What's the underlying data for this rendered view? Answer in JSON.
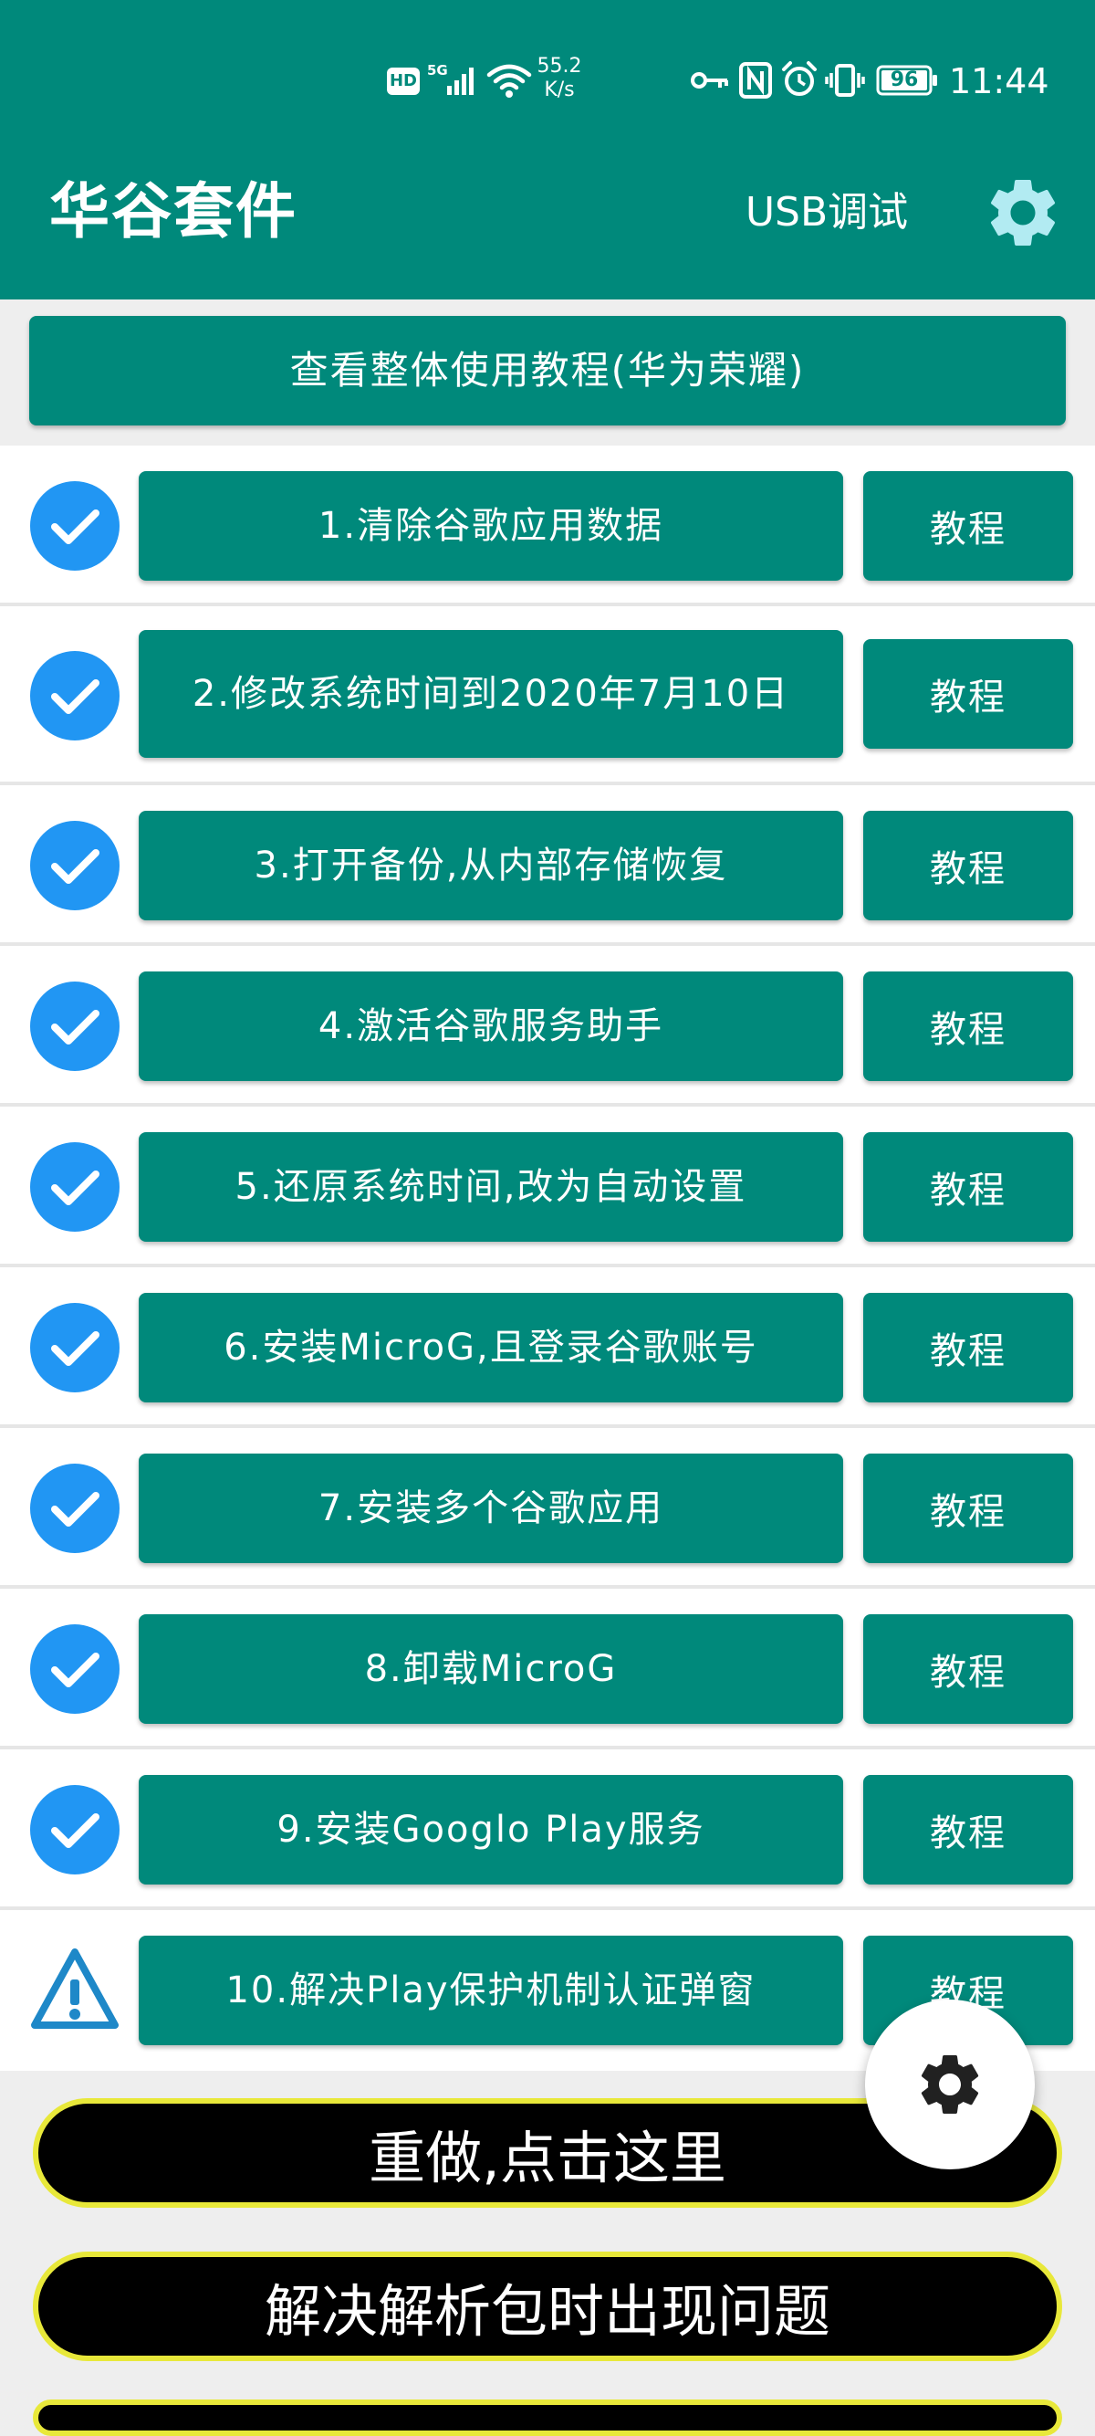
{
  "status_bar": {
    "hd_label": "HD",
    "network_label": "5G",
    "speed_value": "55.2",
    "speed_unit": "K/s",
    "battery_level": "96",
    "time": "11:44",
    "icons": [
      "hd-icon",
      "signal-icon",
      "wifi-icon",
      "key-icon",
      "nfc-icon",
      "alarm-icon",
      "vibrate-icon",
      "battery-icon"
    ]
  },
  "app_bar": {
    "title": "华谷套件",
    "usb_debug_label": "USB调试",
    "settings_icon": "gear-icon"
  },
  "overview_button": {
    "label": "查看整体使用教程(华为荣耀)"
  },
  "steps": [
    {
      "label": "1.清除谷歌应用数据",
      "tutorial_label": "教程",
      "status": "done",
      "status_icon": "check-circle-icon"
    },
    {
      "label": "2.修改系统时间到2020年7月10日",
      "tutorial_label": "教程",
      "status": "done",
      "status_icon": "check-circle-icon"
    },
    {
      "label": "3.打开备份,从内部存储恢复",
      "tutorial_label": "教程",
      "status": "done",
      "status_icon": "check-circle-icon"
    },
    {
      "label": "4.激活谷歌服务助手",
      "tutorial_label": "教程",
      "status": "done",
      "status_icon": "check-circle-icon"
    },
    {
      "label": "5.还原系统时间,改为自动设置",
      "tutorial_label": "教程",
      "status": "done",
      "status_icon": "check-circle-icon"
    },
    {
      "label": "6.安装MicroG,且登录谷歌账号",
      "tutorial_label": "教程",
      "status": "done",
      "status_icon": "check-circle-icon"
    },
    {
      "label": "7.安装多个谷歌应用",
      "tutorial_label": "教程",
      "status": "done",
      "status_icon": "check-circle-icon"
    },
    {
      "label": "8.卸载MicroG",
      "tutorial_label": "教程",
      "status": "done",
      "status_icon": "check-circle-icon"
    },
    {
      "label": "9.安装Googlo Play服务",
      "tutorial_label": "教程",
      "status": "done",
      "status_icon": "check-circle-icon"
    },
    {
      "label": "10.解决Play保护机制认证弹窗",
      "tutorial_label": "教程",
      "status": "warning",
      "status_icon": "warning-icon"
    }
  ],
  "actions": {
    "redo_label": "重做,点击这里",
    "parse_issue_label": "解决解析包时出现问题"
  },
  "fab": {
    "icon": "gear-icon"
  },
  "colors": {
    "primary": "#00897B",
    "check_blue": "#2196F3",
    "action_bg": "#000000",
    "action_border": "#E8E83A",
    "divider": "#E6E6E6",
    "background": "#EEEEEE"
  }
}
